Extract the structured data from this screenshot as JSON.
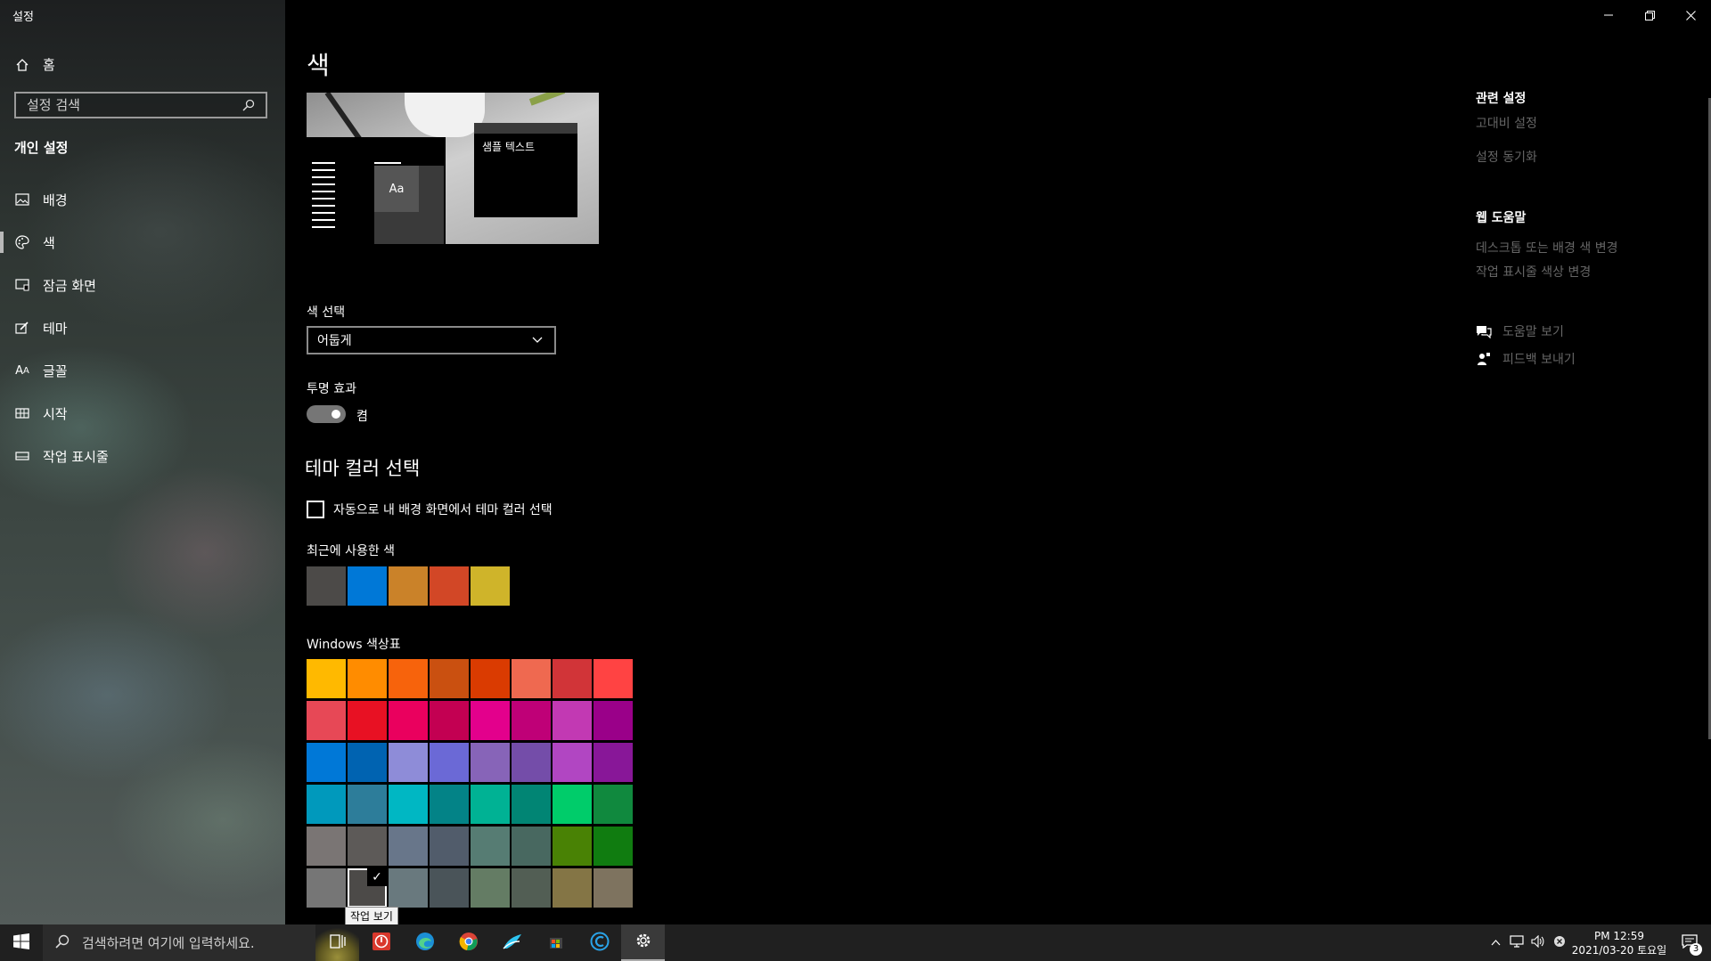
{
  "window": {
    "title": "설정"
  },
  "sidebar": {
    "home_label": "홈",
    "search_placeholder": "설정 검색",
    "section_label": "개인 설정",
    "items": [
      {
        "label": "배경",
        "icon": "image-icon"
      },
      {
        "label": "색",
        "icon": "palette-icon",
        "active": true
      },
      {
        "label": "잠금 화면",
        "icon": "lock-screen-icon"
      },
      {
        "label": "테마",
        "icon": "theme-icon"
      },
      {
        "label": "글꼴",
        "icon": "font-icon"
      },
      {
        "label": "시작",
        "icon": "start-icon"
      },
      {
        "label": "작업 표시줄",
        "icon": "taskbar-icon"
      }
    ]
  },
  "main": {
    "title": "색",
    "preview": {
      "sample_text": "샘플 텍스트",
      "tile_text": "Aa"
    },
    "color_choice": {
      "label": "색 선택",
      "value": "어둡게"
    },
    "transparency": {
      "label": "투명 효과",
      "state": "켬",
      "on": true
    },
    "theme_color": {
      "heading": "테마 컬러 선택",
      "auto_checkbox_label": "자동으로 내 배경 화면에서 테마 컬러 선택",
      "auto_checked": false,
      "recent_label": "최근에 사용한 색",
      "recent_colors": [
        "#4c4a48",
        "#0078d7",
        "#ca8229",
        "#d24726",
        "#cfb42a"
      ],
      "palette_label": "Windows 색상표",
      "palette": [
        [
          "#ffb900",
          "#ff8c00",
          "#f7630c",
          "#ca5010",
          "#da3b01",
          "#ef6950",
          "#d13438",
          "#ff4343"
        ],
        [
          "#e74856",
          "#e81123",
          "#ea005e",
          "#c30052",
          "#e3008c",
          "#bf0077",
          "#c239b3",
          "#9a0089"
        ],
        [
          "#0078d7",
          "#0063b1",
          "#8e8cd8",
          "#6b69d6",
          "#8764b8",
          "#744da9",
          "#b146c2",
          "#881798"
        ],
        [
          "#0099bc",
          "#2d7d9a",
          "#00b7c3",
          "#038387",
          "#00b294",
          "#018574",
          "#00cc6a",
          "#10893e"
        ],
        [
          "#7a7574",
          "#5d5a58",
          "#68768a",
          "#515c6b",
          "#567c73",
          "#486860",
          "#498205",
          "#107c10"
        ],
        [
          "#767676",
          "#4c4a48",
          "#69797e",
          "#4a5459",
          "#647c64",
          "#525e54",
          "#847545",
          "#7e735f"
        ]
      ],
      "selected": [
        5,
        1
      ],
      "tooltip": "작업 보기"
    }
  },
  "related": {
    "heading": "관련 설정",
    "links": [
      "고대비 설정",
      "설정 동기화"
    ],
    "web_help_heading": "웹 도움말",
    "web_links": [
      "데스크톱 또는 배경 색 변경",
      "작업 표시줄 색상 변경"
    ],
    "get_help": "도움말 보기",
    "feedback": "피드백 보내기"
  },
  "taskbar": {
    "search_placeholder": "검색하려면 여기에 입력하세요.",
    "clock_time": "PM 12:59",
    "clock_date": "2021/03-20 토요일",
    "notification_count": "3"
  }
}
